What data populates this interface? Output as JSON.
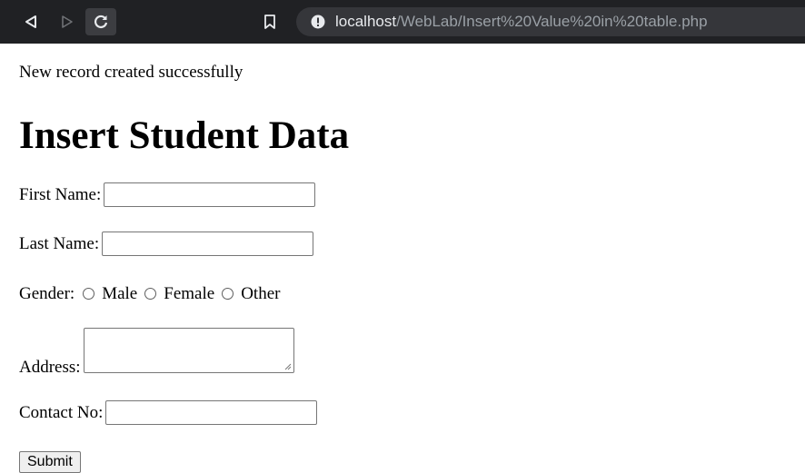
{
  "browser": {
    "url_host": "localhost",
    "url_path": "/WebLab/Insert%20Value%20in%20table.php"
  },
  "page": {
    "status_message": "New record created successfully",
    "title": "Insert Student Data"
  },
  "form": {
    "first_name_label": "First Name:",
    "first_name_value": "",
    "last_name_label": "Last Name:",
    "last_name_value": "",
    "gender_label": "Gender:",
    "gender_options": [
      "Male",
      "Female",
      "Other"
    ],
    "address_label": "Address:",
    "address_value": "",
    "contact_label": "Contact No:",
    "contact_value": "",
    "submit_label": "Submit"
  },
  "colors": {
    "chrome_bg": "#202124",
    "omnibox_bg": "#35363a",
    "url_host": "#e8eaed",
    "url_path": "#9aa0a6"
  }
}
